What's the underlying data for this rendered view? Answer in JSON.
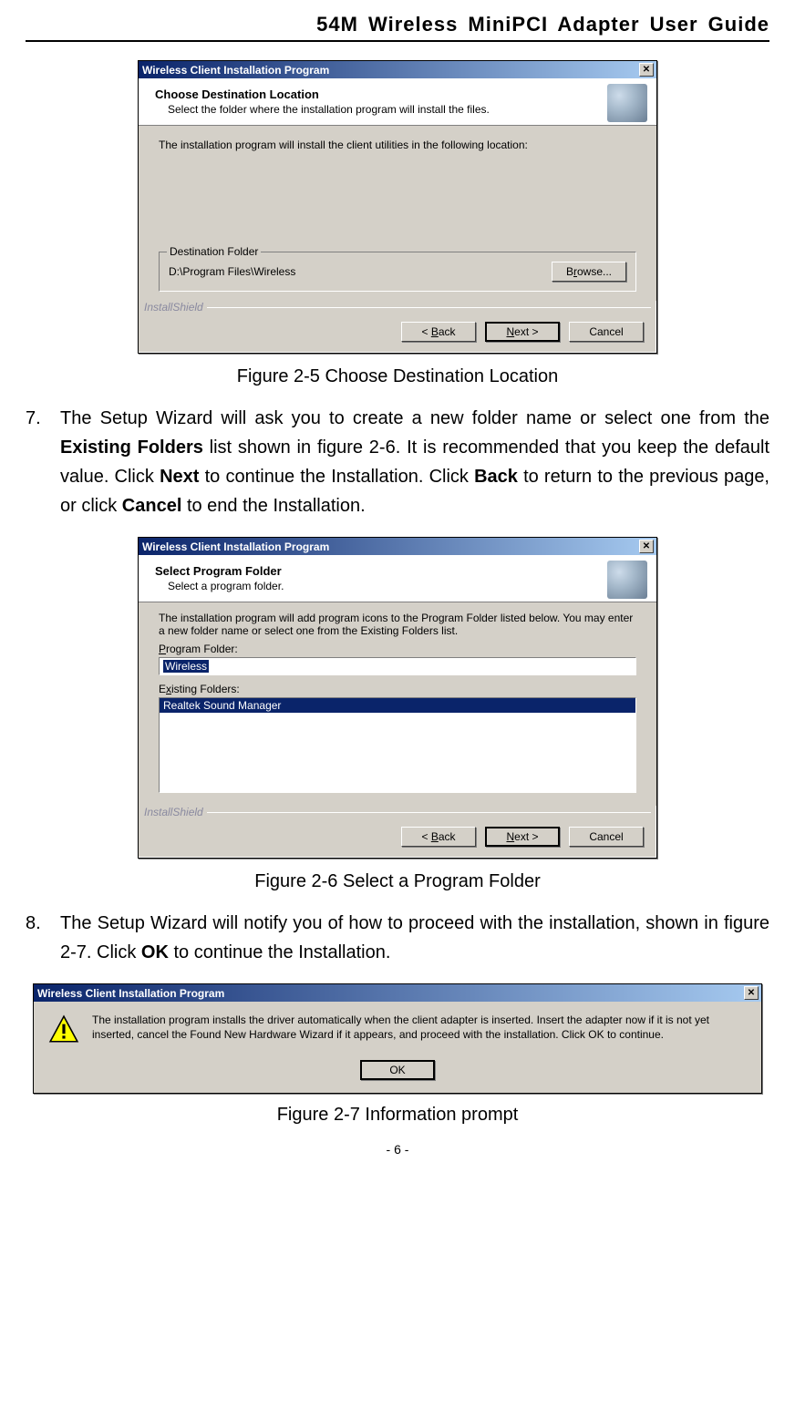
{
  "header": {
    "title": "54M Wireless MiniPCI Adapter User Guide"
  },
  "dialog1": {
    "window_title": "Wireless Client Installation Program",
    "h_title": "Choose Destination Location",
    "h_sub": "Select the folder where the installation program will install the files.",
    "body_txt": "The installation program will install the client utilities in the following location:",
    "legend": "Destination Folder",
    "path": "D:\\Program Files\\Wireless",
    "browse": "Browse...",
    "ishield": "InstallShield",
    "back": "< Back",
    "next": "Next >",
    "cancel": "Cancel"
  },
  "caption1": "Figure 2-5    Choose Destination Location",
  "para7": {
    "num": "7.",
    "t1": "The Setup Wizard will ask you to create a new folder name or select one from the ",
    "b1": "Existing Folders",
    "t2": " list shown in figure 2-6. It is recommended that you keep the default value. Click ",
    "b2": "Next",
    "t3": " to continue the Installation. Click ",
    "b3": "Back",
    "t4": " to return to the previous page, or click ",
    "b4": "Cancel",
    "t5": " to end the Installation."
  },
  "dialog2": {
    "window_title": "Wireless Client Installation Program",
    "h_title": "Select Program Folder",
    "h_sub": "Select a program folder.",
    "body_txt": "The installation program will add program icons to the Program Folder listed below. You may enter a new folder name or select one from the Existing Folders list.",
    "lbl_program": "Program Folder:",
    "program_value": "Wireless",
    "lbl_existing": "Existing Folders:",
    "existing_item": "Realtek Sound Manager",
    "ishield": "InstallShield",
    "back": "< Back",
    "next": "Next >",
    "cancel": "Cancel"
  },
  "caption2": "Figure 2-6    Select a Program Folder",
  "para8": {
    "num": "8.",
    "t1": "The Setup Wizard will notify you of how to proceed with the installation, shown in figure 2-7. Click ",
    "b1": "OK",
    "t2": " to continue the Installation."
  },
  "dialog3": {
    "window_title": "Wireless Client Installation Program",
    "warn_txt": "The installation program installs the driver automatically when the client adapter is inserted. Insert the adapter now if it is not yet inserted, cancel the Found New Hardware Wizard if it appears, and proceed with the installation. Click OK to continue.",
    "ok": "OK"
  },
  "caption3": "Figure 2-7    Information prompt",
  "footer": {
    "page": "- 6 -"
  }
}
